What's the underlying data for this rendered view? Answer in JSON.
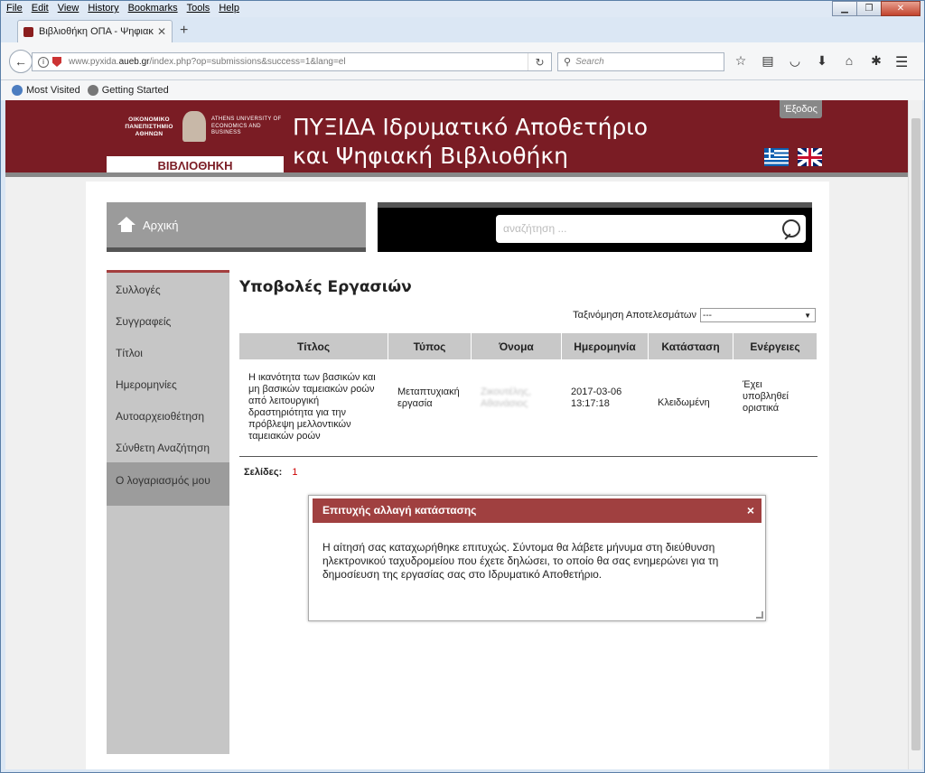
{
  "browser": {
    "menu": [
      "File",
      "Edit",
      "View",
      "History",
      "Bookmarks",
      "Tools",
      "Help"
    ],
    "tab_title": "Βιβλιοθήκη ΟΠΑ - Ψηφιακ...",
    "url_prefix": "www.pyxida.",
    "url_domain": "aueb.gr",
    "url_rest": "/index.php?op=submissions&success=1&lang=el",
    "search_placeholder": "Search",
    "bookmarks": [
      "Most Visited",
      "Getting Started"
    ]
  },
  "header": {
    "logo_greek": "ΟΙΚΟΝΟΜΙΚΟ ΠΑΝΕΠΙΣΤΗΜΙΟ ΑΘΗΝΩΝ",
    "logo_english": "ATHENS UNIVERSITY OF ECONOMICS AND BUSINESS",
    "library_label": "ΒΙΒΛΙΟΘΗΚΗ",
    "title_line1": "ΠΥΞΙΔΑ Ιδρυματικό Αποθετήριο",
    "title_line2": "και Ψηφιακή Βιβλιοθήκη",
    "logout": "Έξοδος"
  },
  "nav": {
    "home": "Αρχική",
    "search_placeholder": "αναζήτηση ..."
  },
  "sidebar": {
    "items": [
      {
        "label": "Συλλογές"
      },
      {
        "label": "Συγγραφείς"
      },
      {
        "label": "Τίτλοι"
      },
      {
        "label": "Ημερομηνίες"
      },
      {
        "label": "Αυτοαρχειοθέτηση"
      },
      {
        "label": "Σύνθετη Αναζήτηση"
      },
      {
        "label": "Ο λογαριασμός μου"
      }
    ]
  },
  "main": {
    "title": "Υποβολές Εργασιών",
    "sort_label": "Ταξινόμηση Αποτελεσμάτων",
    "sort_value": "---",
    "columns": [
      "Τίτλος",
      "Τύπος",
      "Όνομα",
      "Ημερομηνία",
      "Κατάσταση",
      "Ενέργειες"
    ],
    "row": {
      "title": "Η ικανότητα των βασικών και μη βασικών ταμειακών ροών από λειτουργική δραστηριότητα για την πρόβλεψη μελλοντικών ταμειακών ροών",
      "type": "Μεταπτυχιακή εργασία",
      "name": "Ζικουτέλης, Αθανάσιος",
      "date": "2017-03-06 13:17:18",
      "status": "Κλειδωμένη",
      "actions": "Έχει υποβληθεί οριστικά"
    },
    "pages_label": "Σελίδες:",
    "page_number": "1"
  },
  "modal": {
    "title": "Επιτυχής αλλαγή κατάστασης",
    "close": "×",
    "body": "Η αίτησή σας καταχωρήθηκε επιτυχώς. Σύντομα θα λάβετε μήνυμα στη διεύθυνση ηλεκτρονικού ταχυδρομείου που έχετε δηλώσει, το οποίο θα σας ενημερώνει για τη δημοσίευση της εργασίας σας στο Ιδρυματικό Αποθετήριο."
  }
}
